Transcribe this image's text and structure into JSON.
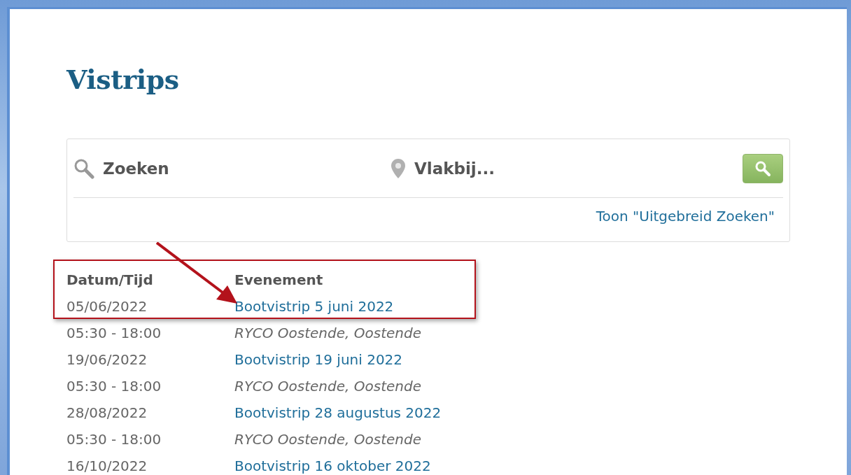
{
  "page": {
    "title": "Vistrips"
  },
  "search": {
    "query_placeholder": "Zoeken",
    "location_placeholder": "Vlakbij...",
    "advanced_link": "Toon \"Uitgebreid Zoeken\""
  },
  "table": {
    "columns": [
      "Datum/Tijd",
      "Evenement"
    ],
    "rows": [
      {
        "kind": "event",
        "date": "05/06/2022",
        "title": "Bootvistrip 5 juni 2022"
      },
      {
        "kind": "detail",
        "time": "05:30 - 18:00",
        "location": "RYCO Oostende, Oostende"
      },
      {
        "kind": "event",
        "date": "19/06/2022",
        "title": "Bootvistrip 19 juni 2022"
      },
      {
        "kind": "detail",
        "time": "05:30 - 18:00",
        "location": "RYCO Oostende, Oostende"
      },
      {
        "kind": "event",
        "date": "28/08/2022",
        "title": "Bootvistrip 28 augustus 2022"
      },
      {
        "kind": "detail",
        "time": "05:30 - 18:00",
        "location": "RYCO Oostende, Oostende"
      },
      {
        "kind": "event",
        "date": "16/10/2022",
        "title": "Bootvistrip 16 oktober 2022"
      }
    ]
  },
  "annotations": [
    {
      "kind": "frame"
    },
    {
      "kind": "arrow"
    }
  ]
}
